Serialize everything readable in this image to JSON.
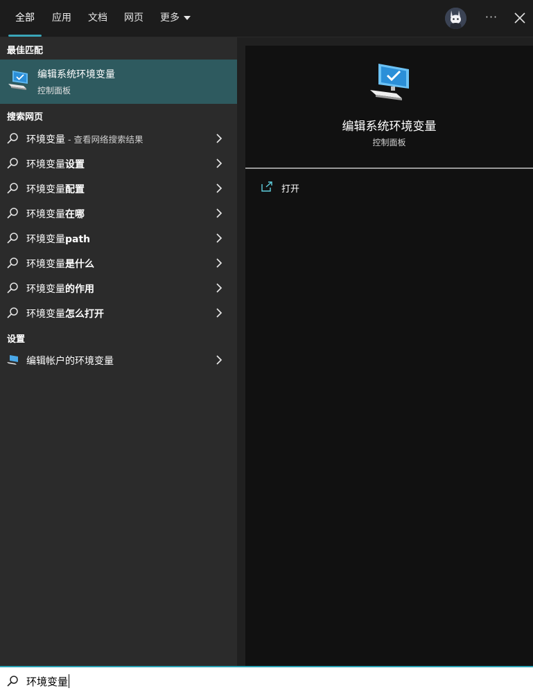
{
  "tabs": [
    {
      "label": "全部",
      "active": true
    },
    {
      "label": "应用"
    },
    {
      "label": "文档"
    },
    {
      "label": "网页"
    },
    {
      "label": "更多"
    }
  ],
  "header": {
    "more_dots": "···"
  },
  "best_match": {
    "section_label": "最佳匹配",
    "title": "编辑系统环境变量",
    "subtitle": "控制面板"
  },
  "web_search": {
    "section_label": "搜索网页",
    "items": [
      {
        "prefix": "环境变量",
        "bold": "",
        "hint": " - 查看网络搜索结果"
      },
      {
        "prefix": "环境变量",
        "bold": "设置",
        "hint": ""
      },
      {
        "prefix": "环境变量",
        "bold": "配置",
        "hint": ""
      },
      {
        "prefix": "环境变量",
        "bold": "在哪",
        "hint": ""
      },
      {
        "prefix": "环境变量",
        "bold": "path",
        "hint": ""
      },
      {
        "prefix": "环境变量",
        "bold": "是什么",
        "hint": ""
      },
      {
        "prefix": "环境变量",
        "bold": "的作用",
        "hint": ""
      },
      {
        "prefix": "环境变量",
        "bold": "怎么打开",
        "hint": ""
      }
    ]
  },
  "settings": {
    "section_label": "设置",
    "items": [
      {
        "label": "编辑帐户的环境变量"
      }
    ]
  },
  "preview": {
    "title": "编辑系统环境变量",
    "subtitle": "控制面板",
    "actions": [
      {
        "label": "打开",
        "icon": "open-icon"
      }
    ]
  },
  "search": {
    "value": "环境变量"
  },
  "colors": {
    "accent": "#3aa6b9",
    "selected_bg": "#2e5a5f"
  }
}
